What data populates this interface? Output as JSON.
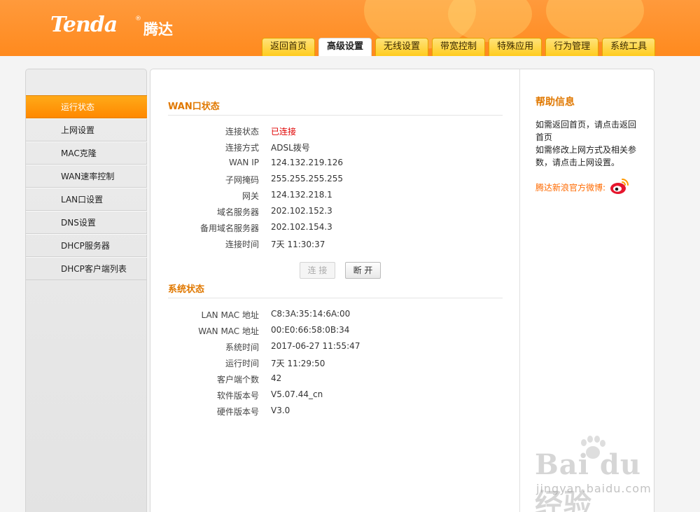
{
  "brand": {
    "logo": "Tenda",
    "reg": "®",
    "name_cn": "腾达"
  },
  "tabs": [
    {
      "label": "返回首页",
      "active": false
    },
    {
      "label": "高级设置",
      "active": true
    },
    {
      "label": "无线设置",
      "active": false
    },
    {
      "label": "带宽控制",
      "active": false
    },
    {
      "label": "特殊应用",
      "active": false
    },
    {
      "label": "行为管理",
      "active": false
    },
    {
      "label": "系统工具",
      "active": false
    }
  ],
  "sidebar": {
    "items": [
      {
        "label": "运行状态",
        "active": true
      },
      {
        "label": "上网设置",
        "active": false
      },
      {
        "label": "MAC克隆",
        "active": false
      },
      {
        "label": "WAN速率控制",
        "active": false
      },
      {
        "label": "LAN口设置",
        "active": false
      },
      {
        "label": "DNS设置",
        "active": false
      },
      {
        "label": "DHCP服务器",
        "active": false
      },
      {
        "label": "DHCP客户端列表",
        "active": false
      }
    ]
  },
  "wan": {
    "title": "WAN口状态",
    "rows": [
      {
        "label": "连接状态",
        "value": "已连接"
      },
      {
        "label": "连接方式",
        "value": "ADSL拨号"
      },
      {
        "label": "WAN IP",
        "value": "124.132.219.126"
      },
      {
        "label": "子网掩码",
        "value": "255.255.255.255"
      },
      {
        "label": "网关",
        "value": "124.132.218.1"
      },
      {
        "label": "域名服务器",
        "value": "202.102.152.3"
      },
      {
        "label": "备用域名服务器",
        "value": "202.102.154.3"
      },
      {
        "label": "连接时间",
        "value": "7天 11:30:37"
      }
    ],
    "connect_label": "连 接",
    "disconnect_label": "断 开"
  },
  "system": {
    "title": "系统状态",
    "rows": [
      {
        "label": "LAN MAC 地址",
        "value": "C8:3A:35:14:6A:00"
      },
      {
        "label": "WAN MAC 地址",
        "value": "00:E0:66:58:0B:34"
      },
      {
        "label": "系统时间",
        "value": "2017-06-27 11:55:47"
      },
      {
        "label": "运行时间",
        "value": "7天 11:29:50"
      },
      {
        "label": "客户端个数",
        "value": "42"
      },
      {
        "label": "软件版本号",
        "value": "V5.07.44_cn"
      },
      {
        "label": "硬件版本号",
        "value": "V3.0"
      }
    ]
  },
  "help": {
    "title": "帮助信息",
    "line1": "如需返回首页，请点击返回首页",
    "line2": "如需修改上网方式及相关参数，请点击上网设置。",
    "weibo_label": "腾达新浪官方微博:",
    "weibo_icon": "weibo-icon"
  },
  "watermark": {
    "text": "Bai du 经验",
    "sub": "jingyan.baidu.com"
  },
  "colors": {
    "accent": "#ff8a1e",
    "title": "#e07800",
    "connected": "#e00000"
  }
}
